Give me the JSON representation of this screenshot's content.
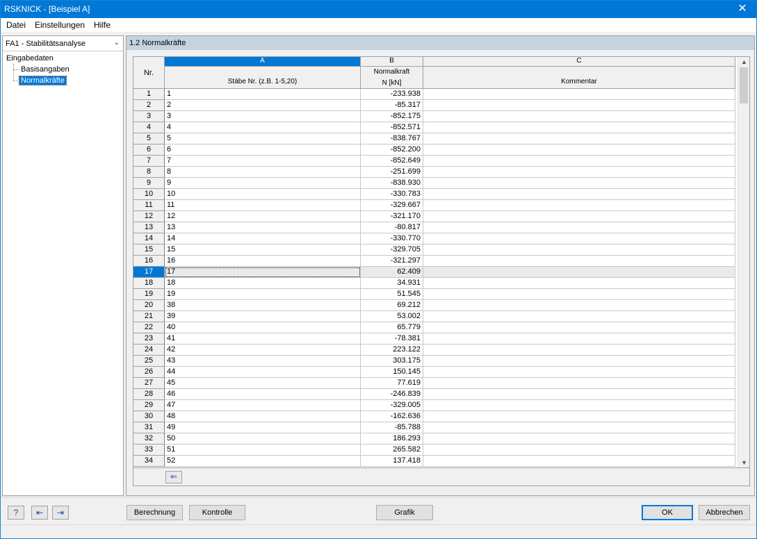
{
  "window": {
    "title": "RSKNICK - [Beispiel A]",
    "close_icon": "close-icon",
    "accent": "#0078d7"
  },
  "menu": {
    "items": [
      "Datei",
      "Einstellungen",
      "Hilfe"
    ]
  },
  "sidebar": {
    "module": "FA1 - Stabilitätsanalyse",
    "tree_root": "Eingabedaten",
    "tree_items": [
      "Basisangaben",
      "Normalkräfte"
    ],
    "selected": "Normalkräfte"
  },
  "section": {
    "title": "1.2 Normalkräfte"
  },
  "table": {
    "col_letters": [
      "A",
      "B",
      "C"
    ],
    "rownum_header": "Nr.",
    "col_a_header": "Stäbe Nr. (z.B. 1-5,20)",
    "col_b_header_1": "Normalkraft",
    "col_b_header_2": "N [kN]",
    "col_c_header": "Kommentar",
    "selected_row": 17,
    "rows": [
      {
        "nr": "1",
        "staebe": "1",
        "n": "-233.938",
        "kommentar": ""
      },
      {
        "nr": "2",
        "staebe": "2",
        "n": "-85.317",
        "kommentar": ""
      },
      {
        "nr": "3",
        "staebe": "3",
        "n": "-852.175",
        "kommentar": ""
      },
      {
        "nr": "4",
        "staebe": "4",
        "n": "-852.571",
        "kommentar": ""
      },
      {
        "nr": "5",
        "staebe": "5",
        "n": "-838.767",
        "kommentar": ""
      },
      {
        "nr": "6",
        "staebe": "6",
        "n": "-852.200",
        "kommentar": ""
      },
      {
        "nr": "7",
        "staebe": "7",
        "n": "-852.649",
        "kommentar": ""
      },
      {
        "nr": "8",
        "staebe": "8",
        "n": "-251.699",
        "kommentar": ""
      },
      {
        "nr": "9",
        "staebe": "9",
        "n": "-838.930",
        "kommentar": ""
      },
      {
        "nr": "10",
        "staebe": "10",
        "n": "-330.783",
        "kommentar": ""
      },
      {
        "nr": "11",
        "staebe": "11",
        "n": "-329.667",
        "kommentar": ""
      },
      {
        "nr": "12",
        "staebe": "12",
        "n": "-321.170",
        "kommentar": ""
      },
      {
        "nr": "13",
        "staebe": "13",
        "n": "-80.817",
        "kommentar": ""
      },
      {
        "nr": "14",
        "staebe": "14",
        "n": "-330.770",
        "kommentar": ""
      },
      {
        "nr": "15",
        "staebe": "15",
        "n": "-329.705",
        "kommentar": ""
      },
      {
        "nr": "16",
        "staebe": "16",
        "n": "-321.297",
        "kommentar": ""
      },
      {
        "nr": "17",
        "staebe": "17",
        "n": "62.409",
        "kommentar": ""
      },
      {
        "nr": "18",
        "staebe": "18",
        "n": "34.931",
        "kommentar": ""
      },
      {
        "nr": "19",
        "staebe": "19",
        "n": "51.545",
        "kommentar": ""
      },
      {
        "nr": "20",
        "staebe": "38",
        "n": "69.212",
        "kommentar": ""
      },
      {
        "nr": "21",
        "staebe": "39",
        "n": "53.002",
        "kommentar": ""
      },
      {
        "nr": "22",
        "staebe": "40",
        "n": "65.779",
        "kommentar": ""
      },
      {
        "nr": "23",
        "staebe": "41",
        "n": "-78.381",
        "kommentar": ""
      },
      {
        "nr": "24",
        "staebe": "42",
        "n": "223.122",
        "kommentar": ""
      },
      {
        "nr": "25",
        "staebe": "43",
        "n": "303.175",
        "kommentar": ""
      },
      {
        "nr": "26",
        "staebe": "44",
        "n": "150.145",
        "kommentar": ""
      },
      {
        "nr": "27",
        "staebe": "45",
        "n": "77.619",
        "kommentar": ""
      },
      {
        "nr": "28",
        "staebe": "46",
        "n": "-246.839",
        "kommentar": ""
      },
      {
        "nr": "29",
        "staebe": "47",
        "n": "-329.005",
        "kommentar": ""
      },
      {
        "nr": "30",
        "staebe": "48",
        "n": "-162.636",
        "kommentar": ""
      },
      {
        "nr": "31",
        "staebe": "49",
        "n": "-85.788",
        "kommentar": ""
      },
      {
        "nr": "32",
        "staebe": "50",
        "n": "186.293",
        "kommentar": ""
      },
      {
        "nr": "33",
        "staebe": "51",
        "n": "265.582",
        "kommentar": ""
      },
      {
        "nr": "34",
        "staebe": "52",
        "n": "137.418",
        "kommentar": ""
      }
    ]
  },
  "footer": {
    "table_tool_icon": "table-export-icon"
  },
  "bottom": {
    "help_icon": "help-icon",
    "prev_icon": "previous-table-icon",
    "next_icon": "next-table-icon",
    "berechnung": "Berechnung",
    "kontrolle": "Kontrolle",
    "grafik": "Grafik",
    "ok": "OK",
    "abbrechen": "Abbrechen"
  }
}
